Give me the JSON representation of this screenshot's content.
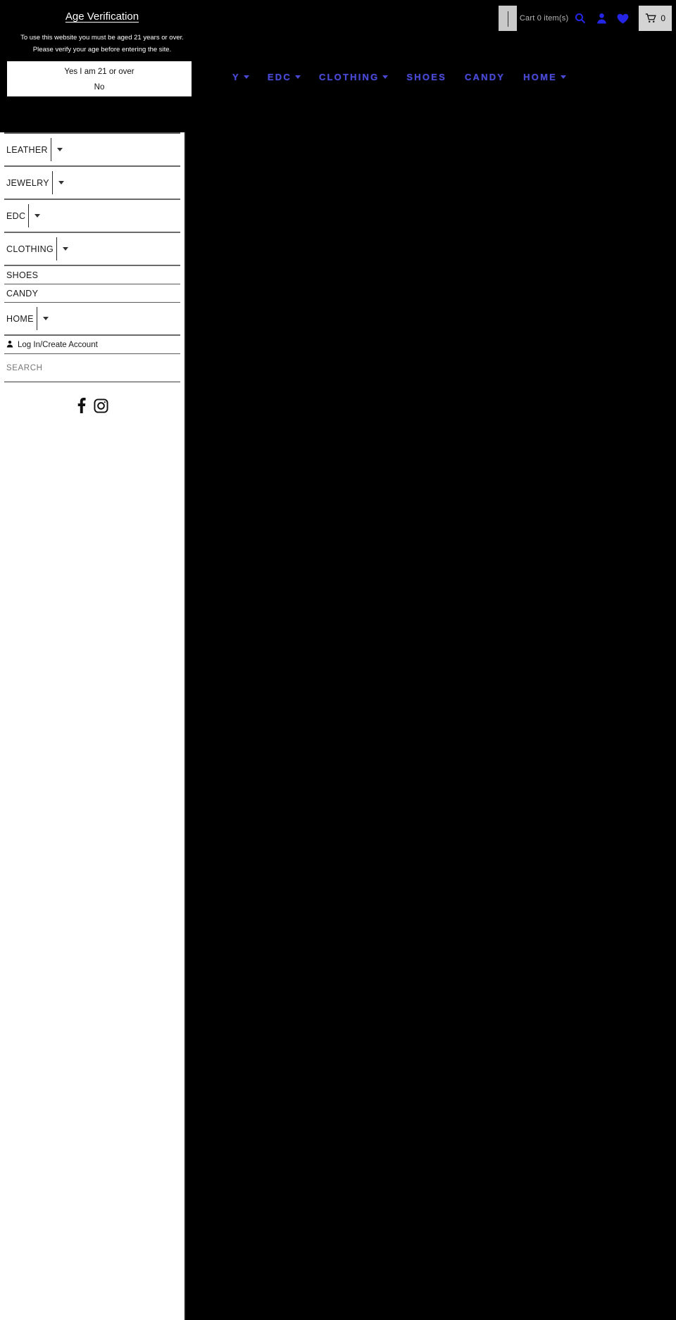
{
  "header": {
    "search": {
      "placeholder": "",
      "value": ""
    },
    "cart_summary": "Cart 0 item(s)",
    "icons": {
      "search": "search-icon",
      "account": "account-icon",
      "wishlist": "heart-icon",
      "cart": "cart-icon"
    },
    "cart_count": "0",
    "accent_color": "#2525e6",
    "cart_button_bg": "#d4d4d4"
  },
  "mainnav": {
    "accent_color": "#4a4ad4",
    "items": [
      {
        "label": "Y",
        "has_dropdown": true
      },
      {
        "label": "EDC",
        "has_dropdown": true
      },
      {
        "label": "CLOTHING",
        "has_dropdown": true
      },
      {
        "label": "SHOES",
        "has_dropdown": false
      },
      {
        "label": "CANDY",
        "has_dropdown": false
      },
      {
        "label": "HOME",
        "has_dropdown": true
      }
    ]
  },
  "age_verification": {
    "title": "Age Verification",
    "description": "To use this website you must be aged 21 years or over. Please verify your age before entering the site.",
    "confirm_label": "Yes I am 21 or over",
    "decline_label": "No"
  },
  "drawer": {
    "items": [
      {
        "label": "LEATHER",
        "has_dropdown": true
      },
      {
        "label": "JEWELRY",
        "has_dropdown": true
      },
      {
        "label": "EDC",
        "has_dropdown": true
      },
      {
        "label": "CLOTHING",
        "has_dropdown": true
      },
      {
        "label": "SHOES",
        "has_dropdown": false
      },
      {
        "label": "CANDY",
        "has_dropdown": false
      },
      {
        "label": "HOME",
        "has_dropdown": true
      }
    ],
    "account_label": "Log In/Create Account",
    "search_placeholder": "SEARCH",
    "search_value": "",
    "social": [
      {
        "name": "facebook-icon"
      },
      {
        "name": "instagram-icon"
      }
    ]
  }
}
